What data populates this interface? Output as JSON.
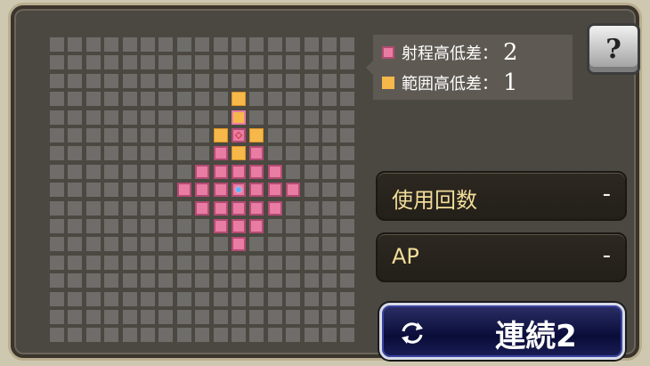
{
  "legend": {
    "shooting_height_label": "射程高低差：",
    "shooting_height_value": "2",
    "area_height_label": "範囲高低差：",
    "area_height_value": "1"
  },
  "help": {
    "label": "?"
  },
  "stats": {
    "uses_label": "使用回数",
    "uses_value": "-",
    "ap_label": "AP",
    "ap_value": "-"
  },
  "action_button": {
    "label": "連続2",
    "icon": "cycle-arrows-icon"
  },
  "grid_info": {
    "rows": 17,
    "cols": 17,
    "range_cells": [
      [
        10,
        4
      ],
      [
        9,
        6
      ],
      [
        11,
        6
      ],
      [
        8,
        7
      ],
      [
        9,
        7
      ],
      [
        10,
        7
      ],
      [
        11,
        7
      ],
      [
        12,
        7
      ],
      [
        7,
        8
      ],
      [
        8,
        8
      ],
      [
        9,
        8
      ],
      [
        10,
        8
      ],
      [
        11,
        8
      ],
      [
        12,
        8
      ],
      [
        13,
        8
      ],
      [
        8,
        9
      ],
      [
        9,
        9
      ],
      [
        10,
        9
      ],
      [
        11,
        9
      ],
      [
        12,
        9
      ],
      [
        9,
        10
      ],
      [
        10,
        10
      ],
      [
        11,
        10
      ],
      [
        10,
        11
      ]
    ],
    "area_cells": [
      [
        10,
        4
      ],
      [
        9,
        5
      ],
      [
        11,
        5
      ],
      [
        10,
        3
      ],
      [
        10,
        6
      ]
    ],
    "target_cell": [
      10,
      5
    ],
    "origin_cell": [
      10,
      8
    ]
  },
  "colors": {
    "range": "#e87ca3",
    "area": "#f6b84a",
    "label_text": "#f1dd98",
    "panel": "#4b4842"
  }
}
